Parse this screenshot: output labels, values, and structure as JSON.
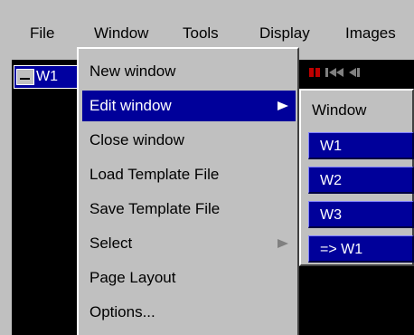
{
  "menubar": {
    "items": [
      "File",
      "Window",
      "Tools",
      "Display",
      "Images"
    ]
  },
  "window_tab": {
    "label": "W1"
  },
  "window_menu": {
    "items": [
      {
        "label": "New window",
        "has_submenu": false,
        "selected": false
      },
      {
        "label": "Edit window",
        "has_submenu": true,
        "selected": true
      },
      {
        "label": "Close window",
        "has_submenu": false,
        "selected": false
      },
      {
        "label": "Load Template File",
        "has_submenu": false,
        "selected": false
      },
      {
        "label": "Save Template File",
        "has_submenu": false,
        "selected": false
      },
      {
        "label": "Select",
        "has_submenu": true,
        "selected": false
      },
      {
        "label": "Page Layout",
        "has_submenu": false,
        "selected": false
      },
      {
        "label": "Options...",
        "has_submenu": false,
        "selected": false
      }
    ]
  },
  "edit_submenu": {
    "header": "Window",
    "buttons": [
      "W1",
      "W2",
      "W3",
      "=> W1"
    ]
  },
  "colors": {
    "background": "#c0c0c0",
    "selection": "#00009a",
    "canvas": "#000000"
  }
}
